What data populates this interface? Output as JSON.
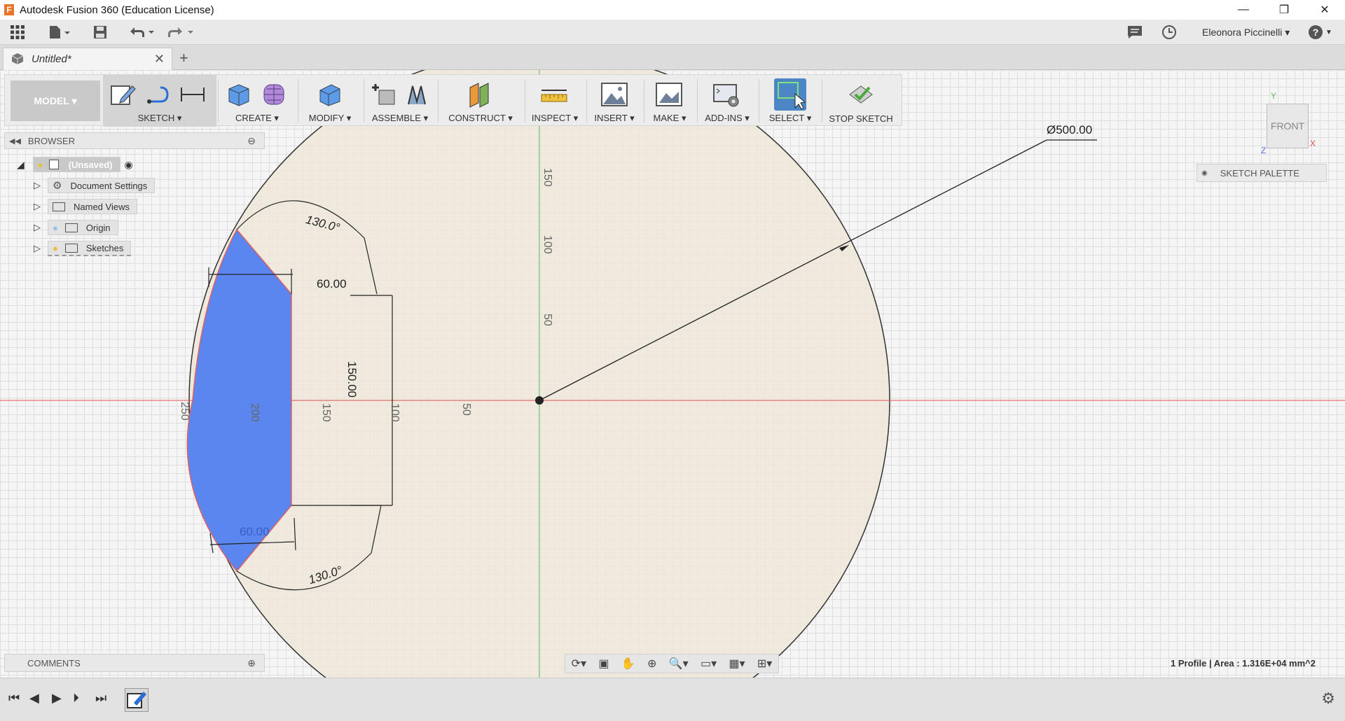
{
  "window": {
    "title": "Autodesk Fusion 360 (Education License)",
    "logo": "F"
  },
  "quick_access": {
    "user": "Eleonora Piccinelli ▾",
    "help": "?"
  },
  "document_tab": {
    "name": "Untitled*",
    "close": "✕",
    "add": "+"
  },
  "toolbar": {
    "mode": "MODEL ▾",
    "groups": [
      {
        "label": "SKETCH ▾"
      },
      {
        "label": "CREATE ▾"
      },
      {
        "label": "MODIFY ▾"
      },
      {
        "label": "ASSEMBLE ▾"
      },
      {
        "label": "CONSTRUCT ▾"
      },
      {
        "label": "INSPECT ▾"
      },
      {
        "label": "INSERT ▾"
      },
      {
        "label": "MAKE ▾"
      },
      {
        "label": "ADD-INS ▾"
      },
      {
        "label": "SELECT ▾"
      },
      {
        "label": "STOP SKETCH"
      }
    ]
  },
  "browser": {
    "title": "BROWSER",
    "root": "(Unsaved)",
    "items": [
      "Document Settings",
      "Named Views",
      "Origin",
      "Sketches"
    ]
  },
  "sketch_palette": {
    "label": "SKETCH PALETTE"
  },
  "comments": {
    "label": "COMMENTS"
  },
  "status": {
    "text": "1 Profile | Area : 1.316E+04 mm^2"
  },
  "viewcube": {
    "face": "FRONT",
    "axis_y": "Y",
    "axis_x": "X",
    "axis_z": "Z"
  },
  "dimensions": {
    "diameter": "Ø500.00",
    "top_width": "60.00",
    "bottom_width": "60.00",
    "height": "150.00",
    "angle_top": "130.0°",
    "angle_bottom": "130.0°"
  },
  "axis_labels": {
    "vertical": [
      "150",
      "100",
      "50"
    ],
    "horizontal": [
      "250",
      "200",
      "150",
      "100",
      "50"
    ]
  },
  "colors": {
    "profile": "#5b86f0",
    "circle_fill": "#efe6d8",
    "x_axis": "#e05050",
    "y_axis": "#58c058",
    "select_active": "#4d86c4"
  }
}
